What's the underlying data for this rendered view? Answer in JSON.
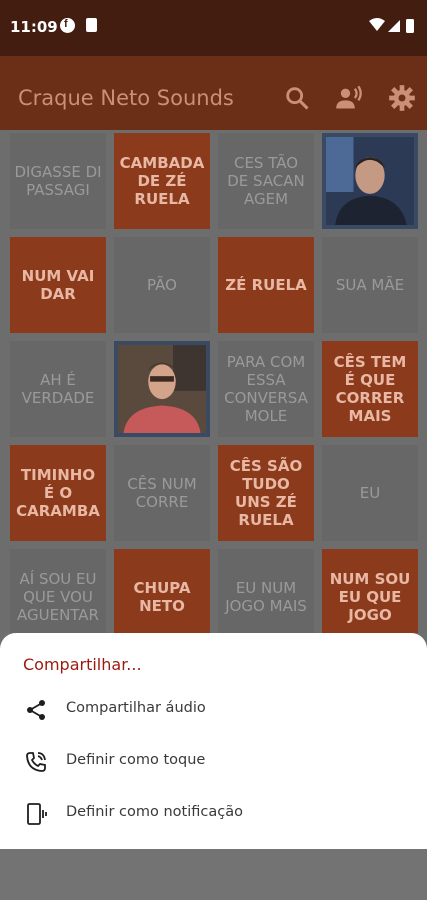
{
  "status_bar": {
    "time": "11:09",
    "notif_icons": [
      "shield-icon",
      "sim-icon"
    ],
    "system_icons": [
      "wifi-icon",
      "signal-icon",
      "battery-icon"
    ]
  },
  "app_bar": {
    "title": "Craque Neto Sounds",
    "actions": [
      "search-icon",
      "voice-icon",
      "gear-icon"
    ]
  },
  "tiles": [
    {
      "label": "DIGASSE DI PASSAGI",
      "style": "gray"
    },
    {
      "label": "CAMBADA DE ZÉ RUELA",
      "style": "orange"
    },
    {
      "label": "CES TÃO DE SACAN AGEM",
      "style": "gray"
    },
    {
      "label": "",
      "style": "photo"
    },
    {
      "label": "NUM VAI DAR",
      "style": "orange"
    },
    {
      "label": "PÃO",
      "style": "gray"
    },
    {
      "label": "ZÉ RUELA",
      "style": "orange"
    },
    {
      "label": "SUA MÃE",
      "style": "gray"
    },
    {
      "label": "AH É VERDADE",
      "style": "gray"
    },
    {
      "label": "",
      "style": "photo"
    },
    {
      "label": "PARA COM ESSA CONVERSA MOLE",
      "style": "gray"
    },
    {
      "label": "CÊS TEM É QUE CORRER MAIS",
      "style": "orange"
    },
    {
      "label": "TIMINHO É O CARAMBA",
      "style": "orange"
    },
    {
      "label": "CÊS NUM CORRE",
      "style": "gray"
    },
    {
      "label": "CÊS SÃO TUDO UNS ZÉ RUELA",
      "style": "orange"
    },
    {
      "label": "EU",
      "style": "gray"
    },
    {
      "label": "AÍ SOU EU QUE VOU AGUENTAR",
      "style": "gray"
    },
    {
      "label": "CHUPA NETO",
      "style": "orange"
    },
    {
      "label": "EU NUM JOGO MAIS",
      "style": "gray"
    },
    {
      "label": "NUM SOU EU QUE JOGO",
      "style": "orange"
    }
  ],
  "sheet": {
    "heading": "Compartilhar...",
    "options": [
      {
        "label": "Compartilhar áudio",
        "icon": "share-icon"
      },
      {
        "label": "Definir como toque",
        "icon": "ringtone-icon"
      },
      {
        "label": "Definir como notificação",
        "icon": "notification-vibrate-icon"
      }
    ]
  },
  "colors": {
    "status_bar": "#431d10",
    "app_bar": "#6b2e17",
    "tile_orange": "#8b3a1c",
    "tile_gray": "#676767",
    "heading_red": "#9b1a0e"
  }
}
